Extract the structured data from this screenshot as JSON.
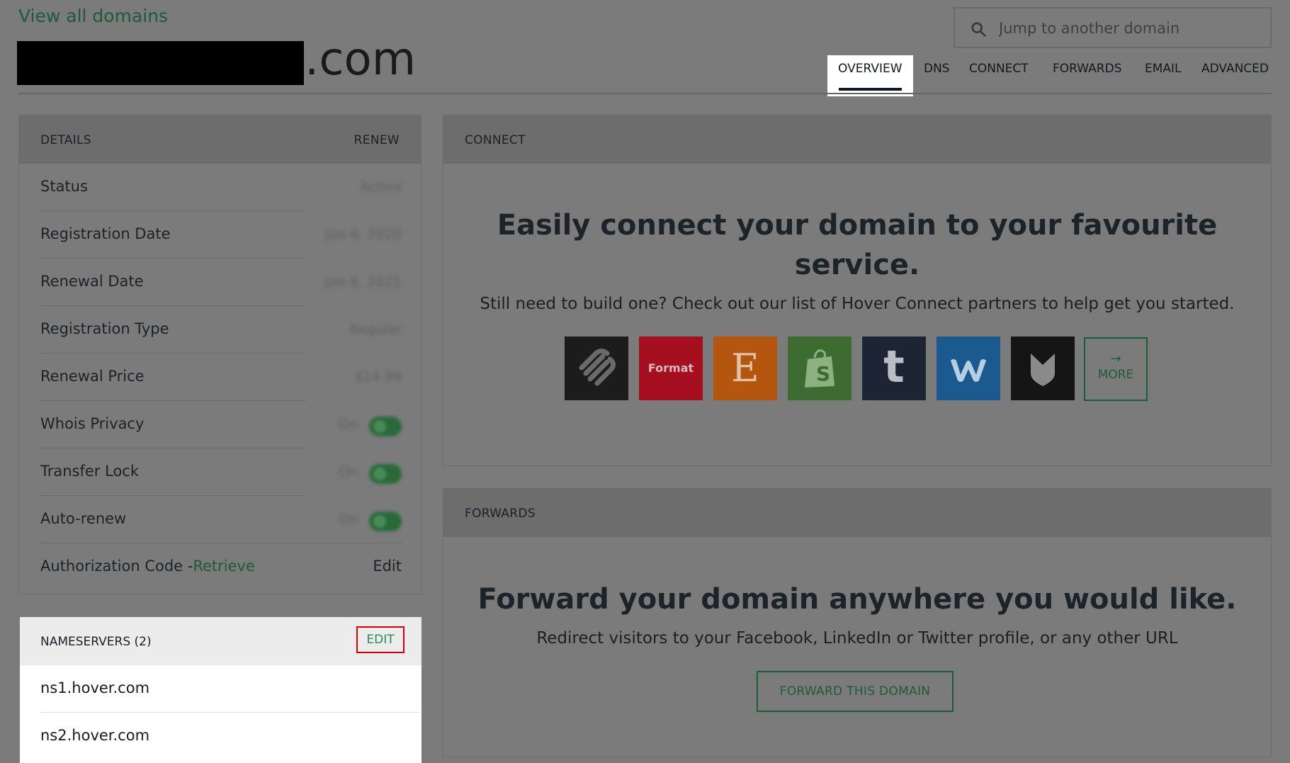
{
  "header": {
    "view_all": "View all domains",
    "domain_tld": ".com",
    "search_placeholder": "Jump to another domain",
    "tabs": [
      "OVERVIEW",
      "DNS",
      "CONNECT",
      "FORWARDS",
      "EMAIL",
      "ADVANCED"
    ],
    "active_tab": "OVERVIEW"
  },
  "details": {
    "title": "DETAILS",
    "renew": "RENEW",
    "rows": [
      {
        "label": "Status",
        "value": "Active"
      },
      {
        "label": "Registration Date",
        "value": "Jan 6, 2020"
      },
      {
        "label": "Renewal Date",
        "value": "Jan 6, 2021"
      },
      {
        "label": "Registration Type",
        "value": "Regular"
      },
      {
        "label": "Renewal Price",
        "value": "$14.99"
      },
      {
        "label": "Whois Privacy",
        "value": "On"
      },
      {
        "label": "Transfer Lock",
        "value": "On"
      },
      {
        "label": "Auto-renew",
        "value": "On"
      }
    ],
    "auth_label": "Authorization Code -",
    "auth_link": "Retrieve",
    "auth_edit": "Edit"
  },
  "nameservers": {
    "title": "NAMESERVERS (2)",
    "edit": "EDIT",
    "items": [
      "ns1.hover.com",
      "ns2.hover.com"
    ]
  },
  "connect": {
    "title": "CONNECT",
    "heading_line1": "Easily connect your domain to your favourite",
    "heading_line2": "service.",
    "subtext": "Still need to build one? Check out our list of Hover Connect partners to help get you started.",
    "services": [
      {
        "name": "squarespace",
        "color": "#1c1c1c"
      },
      {
        "name": "format",
        "label": "Format",
        "color": "#a50f1f"
      },
      {
        "name": "etsy",
        "label": "E",
        "color": "#b4560f"
      },
      {
        "name": "shopify",
        "color": "#3e6b32"
      },
      {
        "name": "tumblr",
        "label": "t",
        "color": "#1d2535"
      },
      {
        "name": "weebly",
        "color": "#1b5a8f"
      },
      {
        "name": "bigcartel",
        "color": "#151515"
      }
    ],
    "more_label": "MORE"
  },
  "forwards": {
    "title": "FORWARDS",
    "heading": "Forward your domain anywhere you would like.",
    "subtext": "Redirect visitors to your Facebook, LinkedIn or Twitter profile, or any other URL",
    "button": "FORWARD THIS DOMAIN"
  }
}
